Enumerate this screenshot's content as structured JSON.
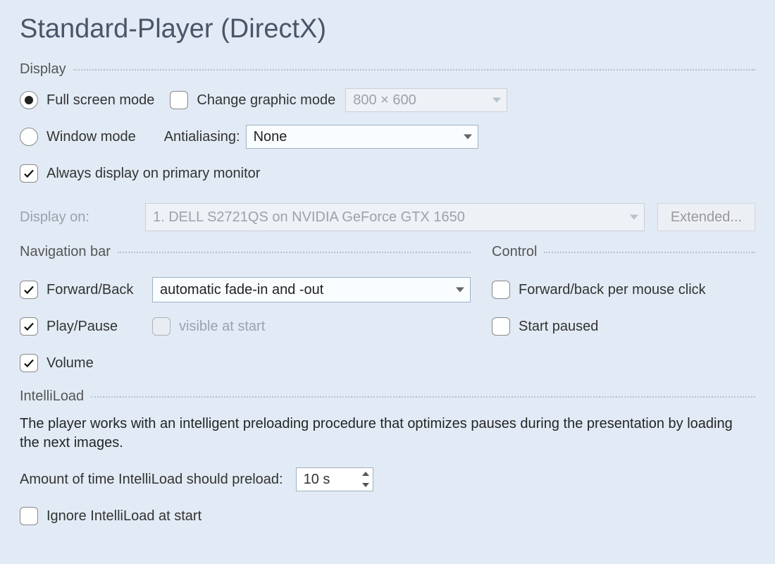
{
  "title": "Standard-Player (DirectX)",
  "display": {
    "legend": "Display",
    "full_screen": "Full screen mode",
    "window_mode": "Window mode",
    "change_graphic": "Change graphic mode",
    "graphic_mode_value": "800 × 600",
    "antialiasing_label": "Antialiasing:",
    "antialiasing_value": "None",
    "always_primary": "Always display on primary monitor",
    "display_on_label": "Display on:",
    "display_on_value": "1. DELL S2721QS on NVIDIA GeForce GTX 1650",
    "extended_btn": "Extended..."
  },
  "nav": {
    "legend": "Navigation bar",
    "forward_back": "Forward/Back",
    "forward_back_mode": "automatic fade-in and -out",
    "play_pause": "Play/Pause",
    "visible_at_start": "visible at start",
    "volume": "Volume"
  },
  "control": {
    "legend": "Control",
    "forward_back_click": "Forward/back per mouse click",
    "start_paused": "Start paused"
  },
  "intelliload": {
    "legend": "IntelliLoad",
    "desc": "The player works with an intelligent preloading procedure that optimizes pauses during the presentation by loading the next images.",
    "amount_label": "Amount of time IntelliLoad should preload:",
    "amount_value": "10 s",
    "ignore": "Ignore IntelliLoad at start"
  }
}
